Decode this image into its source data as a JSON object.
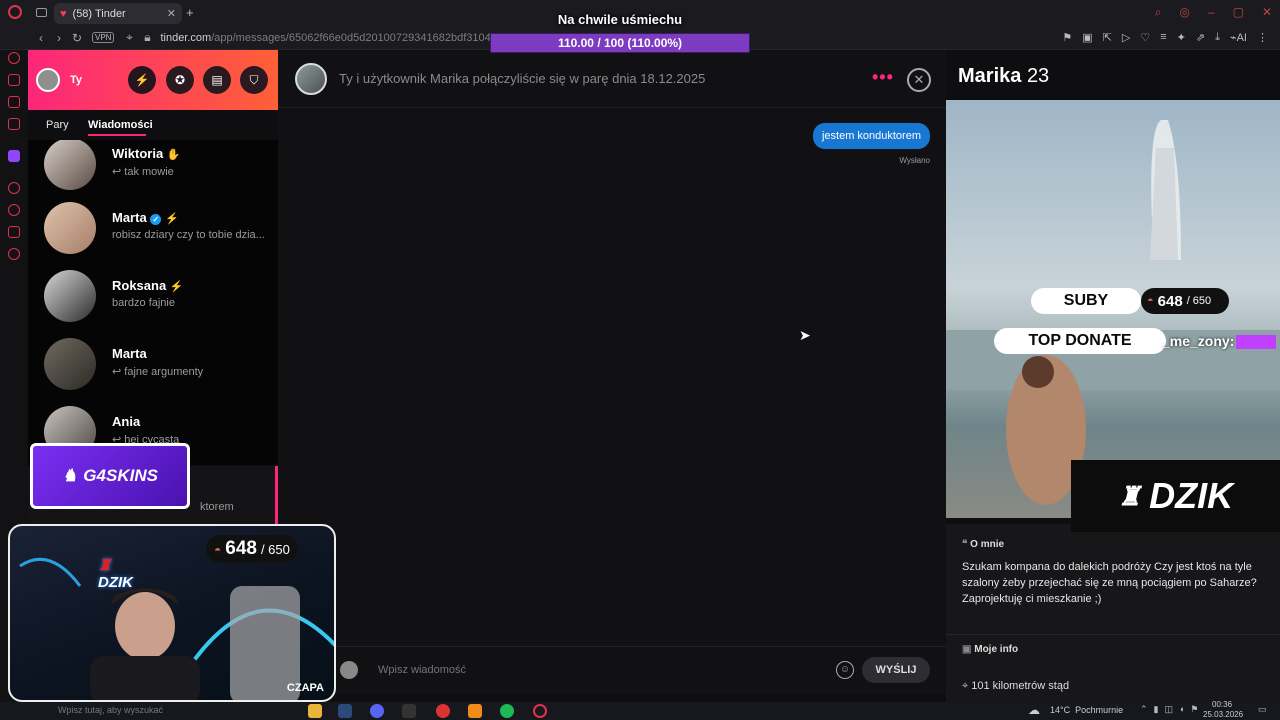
{
  "browser": {
    "tab_title": "(58) Tinder",
    "new_tab": "+",
    "vpn_label": "VPN",
    "url_host": "tinder.com",
    "url_path": "/app/messages/65062f66e0d5d20100729341682bdf310493f343a5f9",
    "ai_label": "AI"
  },
  "left": {
    "user_name": "Ty",
    "tabs": [
      "Pary",
      "Wiadomości"
    ],
    "matches": [
      {
        "name": "Wiktoria",
        "preview": "↩ tak mowie"
      },
      {
        "name": "Marta",
        "preview": "robisz dziary czy to tobie dzia..."
      },
      {
        "name": "Roksana",
        "preview": "bardzo fajnie"
      },
      {
        "name": "Marta",
        "preview": "↩ fajne argumenty"
      },
      {
        "name": "Ania",
        "preview": "↩ hej cycasta"
      }
    ],
    "partial_preview": "ktorem"
  },
  "chat": {
    "header_text": "Ty i użytkownik Marika połączyliście się w parę dnia 18.12.2025",
    "message": "jestem konduktorem",
    "status": "Wysłano",
    "input_placeholder": "Wpisz wiadomość",
    "send_label": "WYŚLIJ"
  },
  "profile": {
    "name": "Marika",
    "age": "23",
    "about_title": "O mnie",
    "about_text": "Szukam kompana do dalekich podróży Czy jest ktoś na tyle szalony żeby przejechać się ze mną pociągiem po Saharze? Zaprojektuję ci mieszkanie ;)",
    "info_title": "Moje info",
    "distance": "101 kilometrów stąd"
  },
  "overlay": {
    "goal_title": "Na chwile uśmiechu",
    "goal_progress": "110.00 / 100 (110.00%)",
    "goal_fraction": 1.1,
    "subs_label": "SUBY",
    "subs_count": "648",
    "subs_total": "/ 650",
    "top_donate_label": "TOP DONATE",
    "top_donor": "_me_zony:",
    "g4skins": "G4SKINS",
    "dzik": "DZIK",
    "webcam_count": "648",
    "webcam_total": "/ 650",
    "webcam_dzik": "DZIK",
    "czapa": "CZAPA"
  },
  "taskbar": {
    "search_placeholder": "Wpisz tutaj, aby wyszukać",
    "weather": "14°C  Pochmurnie",
    "time": "00:36",
    "date": "25.03.2026"
  },
  "colors": {
    "tinder_gradient_start": "#fd267a",
    "tinder_gradient_end": "#ff6036",
    "bubble": "#1877d2",
    "goal_bar": "#7d3bc2",
    "accent_purple": "#c040ff"
  }
}
